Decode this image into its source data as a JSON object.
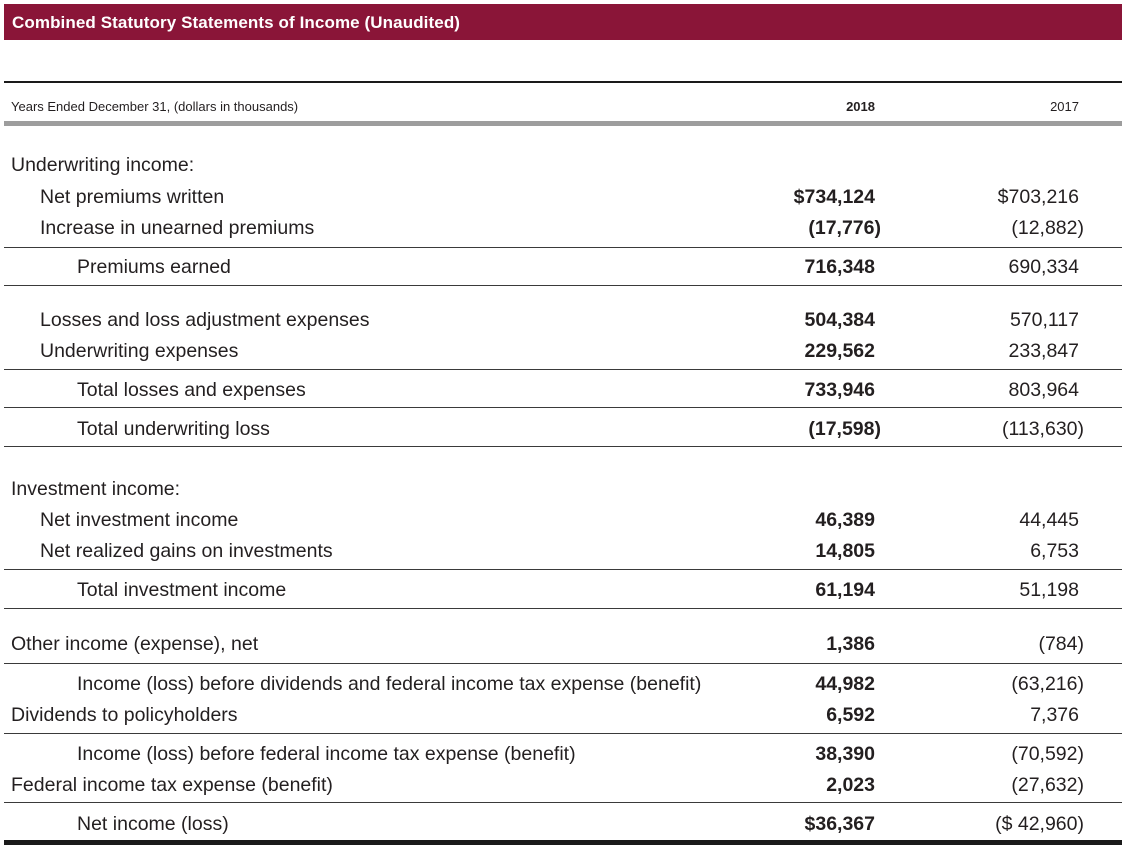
{
  "title": "Combined Statutory Statements of Income (Unaudited)",
  "header": {
    "label": "Years Ended December 31, (dollars in thousands)",
    "year1": "2018",
    "year2": "2017"
  },
  "rows": [
    {
      "label": "Underwriting income:",
      "v2018": "",
      "v2017": ""
    },
    {
      "label": "Net premiums written",
      "v2018": "$734,124",
      "v2017": "$703,216"
    },
    {
      "label": "Increase in unearned premiums",
      "v2018": "(17,776)",
      "v2017": "(12,882)"
    },
    {
      "label": "Premiums earned",
      "v2018": "716,348",
      "v2017": "690,334"
    },
    {
      "label": "Losses and loss adjustment expenses",
      "v2018": "504,384",
      "v2017": "570,117"
    },
    {
      "label": "Underwriting expenses",
      "v2018": "229,562",
      "v2017": "233,847"
    },
    {
      "label": "Total losses and expenses",
      "v2018": "733,946",
      "v2017": "803,964"
    },
    {
      "label": "Total underwriting loss",
      "v2018": "(17,598)",
      "v2017": "(113,630)"
    },
    {
      "label": "Investment income:",
      "v2018": "",
      "v2017": ""
    },
    {
      "label": "Net investment income",
      "v2018": "46,389",
      "v2017": "44,445"
    },
    {
      "label": "Net realized gains on investments",
      "v2018": "14,805",
      "v2017": "6,753"
    },
    {
      "label": "Total investment income",
      "v2018": "61,194",
      "v2017": "51,198"
    },
    {
      "label": "Other income (expense), net",
      "v2018": "1,386",
      "v2017": "(784)"
    },
    {
      "label": "Income (loss) before dividends and federal income tax expense (benefit)",
      "v2018": "44,982",
      "v2017": "(63,216)"
    },
    {
      "label": "Dividends to policyholders",
      "v2018": "6,592",
      "v2017": "7,376"
    },
    {
      "label": "Income (loss) before federal income tax expense (benefit)",
      "v2018": "38,390",
      "v2017": "(70,592)"
    },
    {
      "label": "Federal income tax expense (benefit)",
      "v2018": "2,023",
      "v2017": "(27,632)"
    },
    {
      "label": "Net income (loss)",
      "v2018": "$36,367",
      "v2017": "($ 42,960)"
    }
  ]
}
